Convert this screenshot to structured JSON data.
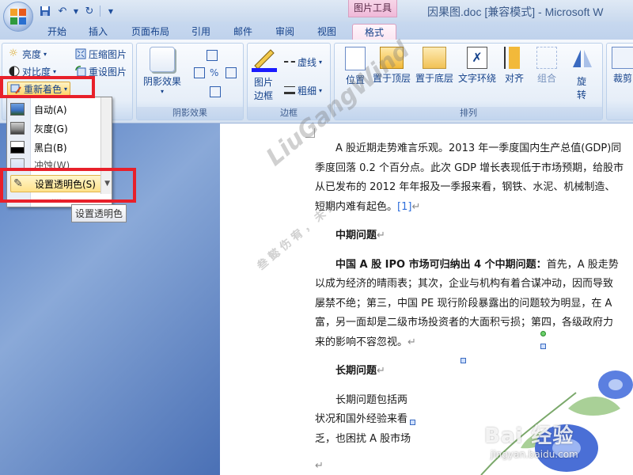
{
  "window": {
    "title": "因果图.doc [兼容模式] - Microsoft W",
    "context_tab_group": "图片工具"
  },
  "tabs": [
    "开始",
    "插入",
    "页面布局",
    "引用",
    "邮件",
    "审阅",
    "视图",
    "格式"
  ],
  "active_tab": "格式",
  "ribbon": {
    "adjust": {
      "brightness": "亮度",
      "contrast": "对比度",
      "recolor": "重新着色",
      "compress": "压缩图片",
      "reset": "重设图片"
    },
    "shadow": {
      "shadow_effect": "阴影效果",
      "group_label": "阴影效果"
    },
    "border": {
      "picture_border_line1": "图片",
      "picture_border_line2": "边框",
      "dashes": "虚线",
      "weight": "粗细",
      "group_label": "边框"
    },
    "arrange": {
      "position": "位置",
      "bring_front": "置于顶层",
      "send_back": "置于底层",
      "text_wrap": "文字环绕",
      "align": "对齐",
      "group": "组合",
      "rotate_line1": "旋",
      "rotate_line2": "转",
      "group_label": "排列"
    },
    "size": {
      "crop": "裁剪"
    }
  },
  "recolor_menu": {
    "items": [
      {
        "label": "自动(A)"
      },
      {
        "label": "灰度(G)"
      },
      {
        "label": "黑白(B)"
      },
      {
        "label": "冲蚀(W)"
      }
    ],
    "set_transparent": "设置透明色(S)",
    "tooltip": "设置透明色"
  },
  "document": {
    "para1": [
      "A 股近期走势难言乐观。2013 年一季度国内生产总值(GDP)同",
      "季度回落 0.2 个百分点。此次 GDP 增长表现低于市场预期，给股市",
      "从已发布的 2012 年年报及一季报来看，钢铁、水泥、机械制造、",
      "短期内难有起色。"
    ],
    "ref1": "[1]",
    "heading_mid": "中期问题",
    "para2_bold": "中国 A 股 IPO 市场可归纳出 4 个中期问题：",
    "para2_rest": "首先，A 股走势",
    "para2": [
      "以成为经济的晴雨表；其次，企业与机构有着合谋冲动，因而导致",
      "屡禁不绝；第三，中国 PE 现行阶段暴露出的问题较为明显，在 A",
      "富，另一面却是二级市场投资者的大面积亏损；第四，各级政府力",
      "来的影响不容忽视。"
    ],
    "heading_long": "长期问题",
    "para3": [
      "长期问题包括两",
      "状况和国外经验来看",
      "乏，也困扰 A 股市场"
    ],
    "para_mark": "↵"
  },
  "watermark": {
    "main": "LiuGangWind",
    "sub": "叁 懿 伤 宥 ， 未 经"
  },
  "baidu_watermark": {
    "brand": "Bai 经验",
    "url": "jingyan.baidu.com"
  }
}
